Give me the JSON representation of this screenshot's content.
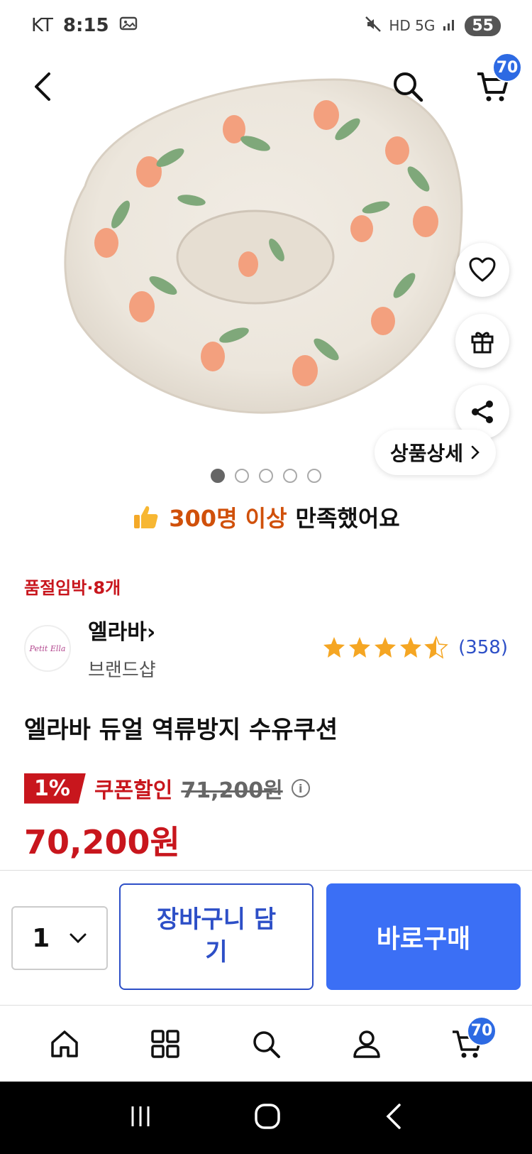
{
  "status_bar": {
    "carrier": "KT",
    "time": "8:15",
    "network": "HD 5G",
    "battery": "55"
  },
  "header": {
    "cart_count": "70"
  },
  "gallery": {
    "detail_label": "상품상세",
    "slide_count": 5,
    "active_slide": 1
  },
  "satisfaction": {
    "accent": "300명 이상",
    "rest": "만족했어요"
  },
  "product": {
    "stock_notice": "품절임박·8개",
    "brand_name": "엘라바",
    "brand_sub": "브랜드샵",
    "brand_logo_text": "Petit Ella",
    "rating_value": 4.5,
    "review_count": "(358)",
    "title": "엘라바 듀얼 역류방지 수유쿠션",
    "discount_pct": "1%",
    "coupon_label": "쿠폰할인",
    "original_price": "71,200원",
    "final_price": "70,200원"
  },
  "purchase": {
    "quantity": "1",
    "cart_button": "장바구니 담기",
    "buy_button": "바로구매"
  },
  "tabbar": {
    "cart_count": "70"
  },
  "colors": {
    "accent_blue": "#3b6ff5",
    "price_red": "#c8161d",
    "satisfaction_orange": "#d0500a",
    "star": "#f5a623"
  }
}
